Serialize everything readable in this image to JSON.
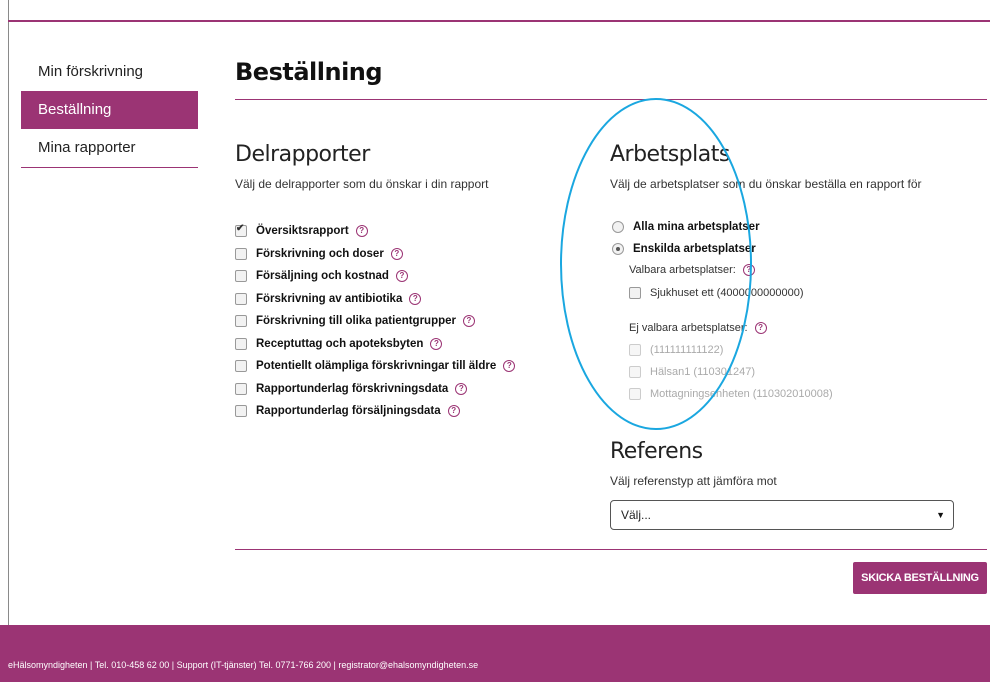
{
  "sidebar": {
    "items": [
      {
        "label": "Min förskrivning"
      },
      {
        "label": "Beställning"
      },
      {
        "label": "Mina rapporter"
      }
    ]
  },
  "page": {
    "title": "Beställning"
  },
  "delrapporter": {
    "heading": "Delrapporter",
    "description": "Välj de delrapporter som du önskar i din rapport",
    "items": [
      {
        "label": "Översiktsrapport",
        "checked": true
      },
      {
        "label": "Förskrivning och doser",
        "checked": false
      },
      {
        "label": "Försäljning och kostnad",
        "checked": false
      },
      {
        "label": "Förskrivning av antibiotika",
        "checked": false
      },
      {
        "label": "Förskrivning till olika patientgrupper",
        "checked": false
      },
      {
        "label": "Receptuttag och apoteksbyten",
        "checked": false
      },
      {
        "label": "Potentiellt olämpliga förskrivningar till äldre",
        "checked": false
      },
      {
        "label": "Rapportunderlag förskrivningsdata",
        "checked": false
      },
      {
        "label": "Rapportunderlag försäljningsdata",
        "checked": false
      }
    ]
  },
  "arbetsplats": {
    "heading": "Arbetsplats",
    "description": "Välj de arbetsplatser som du önskar beställa en rapport för",
    "radio_all": "Alla mina arbetsplatser",
    "radio_single": "Enskilda arbetsplatser",
    "selectable_label": "Valbara arbetsplatser:",
    "selectable": [
      "Sjukhuset ett (4000000000000)"
    ],
    "unselectable_label": "Ej valbara arbetsplatser:",
    "unselectable": [
      "(111111111122)",
      "Hälsan1 (110301247)",
      "Mottagningsenheten (110302010008)"
    ]
  },
  "referens": {
    "heading": "Referens",
    "description": "Välj referenstyp att jämföra mot",
    "select_value": "Välj..."
  },
  "actions": {
    "send_label": "SKICKA BESTÄLLNING"
  },
  "footer": {
    "text": "eHälsomyndigheten | Tel. 010-458 62 00 | Support (IT-tjänster) Tel. 0771-766 200 | registrator@ehalsomyndigheten.se"
  },
  "colors": {
    "brand": "#9b3474",
    "annotation": "#1aa7e0"
  }
}
